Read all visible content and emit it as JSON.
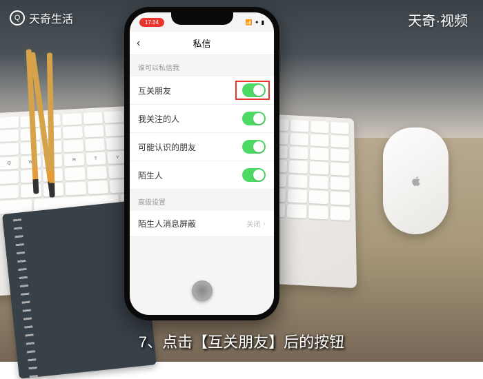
{
  "watermark": {
    "left": "天奇生活",
    "right": "天奇·视频"
  },
  "phone": {
    "status": {
      "time": "17:34"
    },
    "nav": {
      "title": "私信"
    },
    "section1_header": "谁可以私信我",
    "rows": [
      {
        "label": "互关朋友",
        "highlighted": true
      },
      {
        "label": "我关注的人",
        "highlighted": false
      },
      {
        "label": "可能认识的朋友",
        "highlighted": false
      },
      {
        "label": "陌生人",
        "highlighted": false
      }
    ],
    "section2_header": "高级设置",
    "advanced_row": {
      "label": "陌生人消息屏蔽",
      "value": "关闭"
    }
  },
  "caption": "7、点击【互关朋友】后的按钮"
}
